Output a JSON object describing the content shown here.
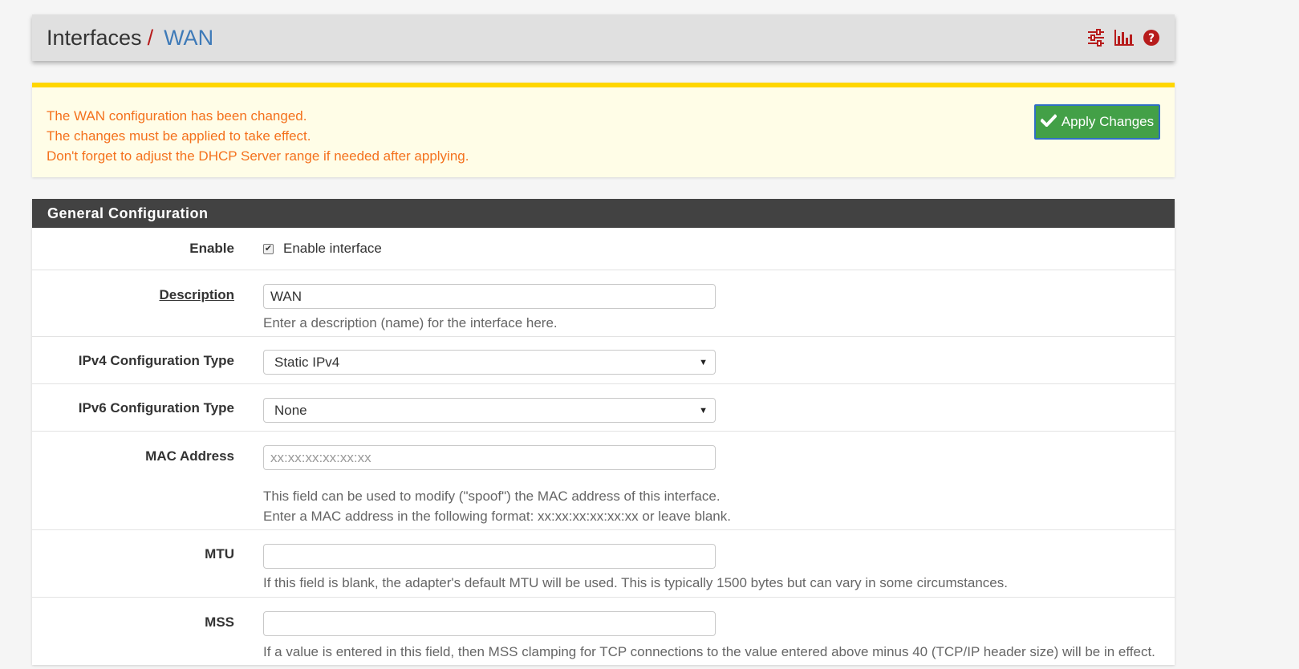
{
  "breadcrumb": {
    "parent": "Interfaces",
    "separator": "/",
    "current": "WAN"
  },
  "header_icons": [
    "sliders-icon",
    "bar-chart-icon",
    "help-icon"
  ],
  "alert": {
    "lines": [
      "The WAN configuration has been changed.",
      "The changes must be applied to take effect.",
      "Don't forget to adjust the DHCP Server range if needed after applying."
    ],
    "apply_button": "Apply Changes"
  },
  "panel": {
    "title": "General Configuration",
    "enable": {
      "label": "Enable",
      "checkbox_label": "Enable interface",
      "checked": true
    },
    "description": {
      "label": "Description",
      "value": "WAN",
      "help": "Enter a description (name) for the interface here."
    },
    "ipv4": {
      "label": "IPv4 Configuration Type",
      "value": "Static IPv4"
    },
    "ipv6": {
      "label": "IPv6 Configuration Type",
      "value": "None"
    },
    "mac": {
      "label": "MAC Address",
      "placeholder": "xx:xx:xx:xx:xx:xx",
      "help1": "This field can be used to modify (\"spoof\") the MAC address of this interface.",
      "help2": "Enter a MAC address in the following format: xx:xx:xx:xx:xx:xx or leave blank."
    },
    "mtu": {
      "label": "MTU",
      "value": "",
      "help": "If this field is blank, the adapter's default MTU will be used. This is typically 1500 bytes but can vary in some circumstances."
    },
    "mss": {
      "label": "MSS",
      "value": "",
      "help": "If a value is entered in this field, then MSS clamping for TCP connections to the value entered above minus 40 (TCP/IP header size) will be in effect."
    }
  },
  "colors": {
    "alert_text": "#f4711d",
    "alert_border": "#ffd600",
    "apply_bg": "#43a047",
    "breadcrumb_link": "#3e7ab8",
    "separator": "#b71c1c",
    "icon_red": "#b71c1c",
    "panel_heading": "#424242"
  }
}
